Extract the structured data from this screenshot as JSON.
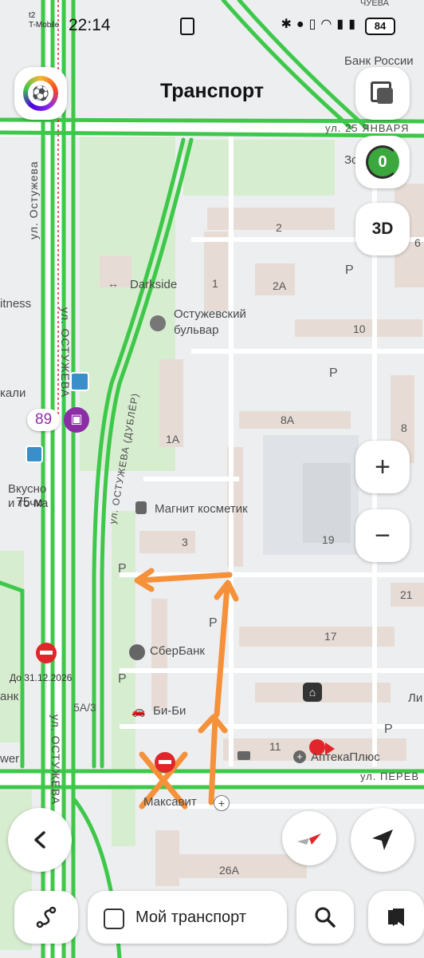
{
  "status_bar": {
    "carrier_line1": "t2",
    "carrier_line2": "T-Mobile",
    "time": "22:14",
    "battery": "84"
  },
  "header": {
    "title": "Транспорт"
  },
  "map": {
    "street_labels": {
      "ostuzheva_1": "ул. Остужева",
      "ostuzheva_2": "ул. ОСТУЖЕВА",
      "ostuzheva_dubler": "ул. ОСТУЖЕВА (ДУБЛЁР)",
      "ostuzheva_3": "ул. ОСТУЖЕВА",
      "25_yanvarya": "ул. 25 ЯНВАРЯ",
      "chueva": "ЧУЕВА",
      "perev": "ул. ПЕРЕВ"
    },
    "poi": {
      "bank_rossii": "Банк России",
      "darkside": "Darkside",
      "ostuzhevsky_1": "Остужевский",
      "ostuzhevsky_2": "бульвар",
      "magnit": "Магнит косметик",
      "sberbank": "СберБанк",
      "bibi": "Би-Би",
      "apteka": "АптекаПлюс",
      "maksavit": "Максавит",
      "vkusno_1": "Вкусно",
      "vkusno_2": "и точка",
      "fitness": "itness",
      "kali": "кали",
      "bank_left": "анк",
      "wer": "wer",
      "li": "Ли",
      "zo": "Зо"
    },
    "house_numbers": [
      "2",
      "2А",
      "1",
      "10",
      "8А",
      "1А",
      "8",
      "6",
      "3",
      "19",
      "21",
      "17",
      "5А/3",
      "11",
      "26А"
    ],
    "parking_label": "P",
    "closure_note": "До 31.12.2026",
    "distance_label": "75 м",
    "bus_route": "89"
  },
  "controls": {
    "layers_icon": "layers-icon",
    "traffic_score": "0",
    "btn_3d": "3D",
    "zoom_in": "+",
    "zoom_out": "−"
  },
  "bottom": {
    "my_transport_label": "Мой транспорт"
  },
  "colors": {
    "route_green": "#3ec84a",
    "annotation_orange": "#f5913a",
    "poi_purple": "#8b2ea6",
    "stop_red": "#e0262a"
  }
}
